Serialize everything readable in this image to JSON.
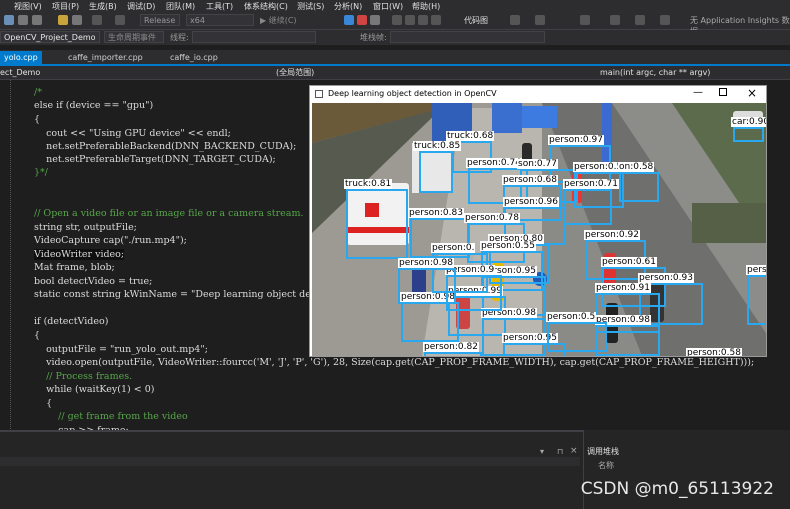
{
  "menu": {
    "items": [
      "视图(V)",
      "项目(P)",
      "生成(B)",
      "调试(D)",
      "团队(M)",
      "工具(T)",
      "体系结构(C)",
      "测试(S)",
      "分析(N)",
      "窗口(W)",
      "帮助(H)"
    ],
    "app_insights": "无 Application Insights 数据"
  },
  "toolbar": {
    "config": "Release",
    "platform": "x64",
    "continue": "继续(C)",
    "code_map": "代码图"
  },
  "projbar": {
    "project": "OpenCV_Project_Demo",
    "lifecycle": "生命周期事件",
    "thread_label": "线程:",
    "stack_label": "堆栈帧:"
  },
  "tabs": [
    "yolo.cpp",
    "caffe_importer.cpp",
    "caffe_io.cpp"
  ],
  "navbar": {
    "project": "ect_Demo",
    "scope": "(全局范围)",
    "function": "main(int argc, char ** argv)"
  },
  "code_lines": [
    {
      "text": "/*",
      "cls": "cm"
    },
    {
      "text": "else if (device == \"gpu\")",
      "cls": ""
    },
    {
      "text": "{",
      "cls": ""
    },
    {
      "text": "    cout << \"Using GPU device\" << endl;",
      "cls": ""
    },
    {
      "text": "    net.setPreferableBackend(DNN_BACKEND_CUDA);",
      "cls": ""
    },
    {
      "text": "    net.setPreferableTarget(DNN_TARGET_CUDA);",
      "cls": ""
    },
    {
      "text": "}*/",
      "cls": "cm"
    },
    {
      "text": "",
      "cls": ""
    },
    {
      "text": "",
      "cls": ""
    },
    {
      "text": "// Open a video file or an image file or a camera stream.",
      "cls": "cm"
    },
    {
      "text": "string str, outputFile;",
      "cls": ""
    },
    {
      "text": "VideoCapture cap(\"./run.mp4\");",
      "cls": ""
    },
    {
      "text": "VideoWriter video;",
      "cls": ""
    },
    {
      "text": "Mat frame, blob;",
      "cls": ""
    },
    {
      "text": "bool detectVideo = true;",
      "cls": ""
    },
    {
      "text": "static const string kWinName = \"Deep learning object detection in OpenCV\";",
      "cls": ""
    },
    {
      "text": "",
      "cls": ""
    },
    {
      "text": "if (detectVideo)",
      "cls": ""
    },
    {
      "text": "{",
      "cls": ""
    },
    {
      "text": "    outputFile = \"run_yolo_out.mp4\";",
      "cls": ""
    },
    {
      "text": "    video.open(outputFile, VideoWriter::fourcc('M', 'J', 'P', 'G'), 28, Size(cap.get(CAP_PROP_FRAME_WIDTH), cap.get(CAP_PROP_FRAME_HEIGHT)));",
      "cls": ""
    },
    {
      "text": "    // Process frames.",
      "cls": "cm"
    },
    {
      "text": "    while (waitKey(1) < 0)",
      "cls": ""
    },
    {
      "text": "    {",
      "cls": ""
    },
    {
      "text": "        // get frame from the video",
      "cls": "cm"
    },
    {
      "text": "        cap >> frame;",
      "cls": ""
    }
  ],
  "cv_window": {
    "title": "Deep learning object detection in OpenCV",
    "detections": [
      {
        "label": "car:0.90"
      },
      {
        "label": "truck:0.68"
      },
      {
        "label": "truck:0.85"
      },
      {
        "label": "truck:0.81"
      },
      {
        "label": "person:0.97"
      },
      {
        "label": "person:0.74"
      },
      {
        "label": "son:0.77"
      },
      {
        "label": "person:0.52"
      },
      {
        "label": "on:0.58"
      },
      {
        "label": "person:0.68"
      },
      {
        "label": "person:0.71"
      },
      {
        "label": "person:0.96"
      },
      {
        "label": "person:0.83"
      },
      {
        "label": "person:0.78"
      },
      {
        "label": "person:0.80"
      },
      {
        "label": "person:0.92"
      },
      {
        "label": "person:0.55"
      },
      {
        "label": "person:0.61"
      },
      {
        "label": "person:0.95"
      },
      {
        "label": "person:0.93"
      },
      {
        "label": "person:0.99"
      },
      {
        "label": "person:0.91"
      },
      {
        "label": "person:0.98"
      },
      {
        "label": "person:0.98"
      },
      {
        "label": "person:0.98"
      },
      {
        "label": "person:0.95"
      },
      {
        "label": "person:0.82"
      },
      {
        "label": "person:0.58"
      },
      {
        "label": "pers"
      },
      {
        "label": "person:0."
      },
      {
        "label": "person:0.9"
      },
      {
        "label": "person:0.5"
      },
      {
        "label": "person:0.98"
      }
    ]
  },
  "bottom": {
    "call_stack": "调用堆栈",
    "name_col": "名称"
  },
  "watermark": "CSDN @m0_65113922",
  "colors": {
    "accent": "#007acc",
    "detection_box": "#29a8f0"
  }
}
